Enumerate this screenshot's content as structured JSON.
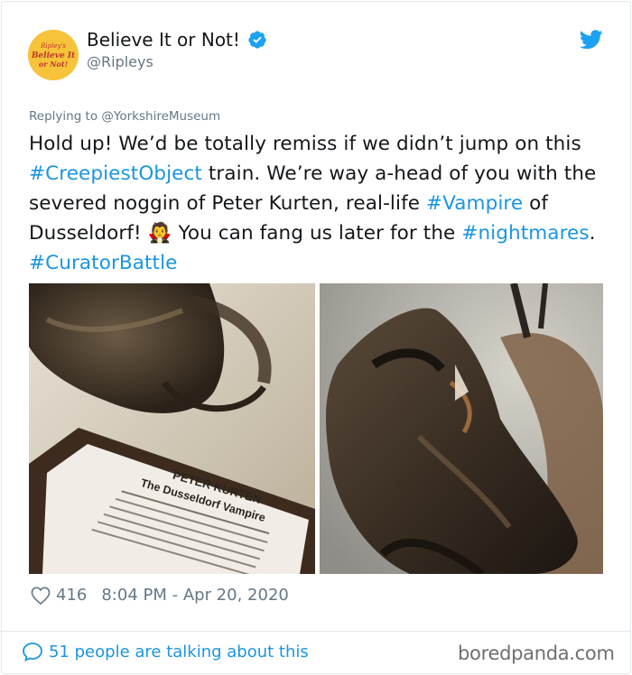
{
  "header": {
    "display_name": "Believe It or Not!",
    "handle": "@Ripleys",
    "avatar_text": [
      "Ripley's",
      "Believe It",
      "or Not!"
    ],
    "verified_icon": "verified-badge-icon",
    "platform_icon": "twitter-bird-icon"
  },
  "reply": {
    "prefix": "Replying to",
    "mention": "@YorkshireMuseum"
  },
  "tweet": {
    "t1": "Hold up! We’d be totally remiss if we didn’t jump on this ",
    "tag1": "#CreepiestObject",
    "t2": " train. We’re way a-head of you with the severed noggin of Peter Kurten, real-life ",
    "tag2": "#Vampire",
    "t3": " of Dusseldorf! ",
    "emoji": "🧛",
    "t4": " You can fang us later for the ",
    "tag3": "#nightmares",
    "t5": ". ",
    "tag4": "#CuratorBattle"
  },
  "images": {
    "left_sign_title": "PETER KURTEN",
    "left_sign_subtitle": "The Dusseldorf Vampire"
  },
  "meta": {
    "likes": "416",
    "timestamp": "8:04 PM - Apr 20, 2020"
  },
  "footer": {
    "talking": "51 people are talking about this",
    "watermark": "boredpanda.com"
  },
  "colors": {
    "link": "#1b95e0",
    "secondary_text": "#657786",
    "avatar_bg": "#f6c33b"
  }
}
